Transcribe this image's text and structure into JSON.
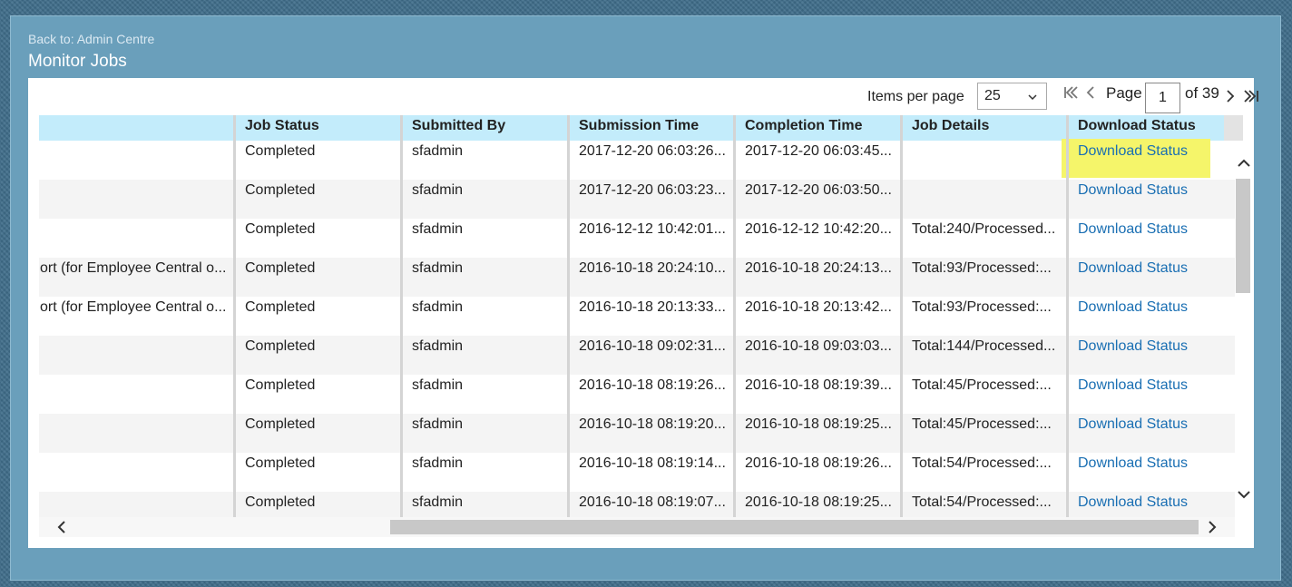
{
  "header": {
    "back_link": "Back to: Admin Centre",
    "title": "Monitor Jobs"
  },
  "pagination": {
    "items_per_page_label": "Items per page",
    "items_per_page_value": "25",
    "page_label": "Page",
    "current_page": "1",
    "of_label": "of 39"
  },
  "table": {
    "columns": [
      "Job Status",
      "Submitted By",
      "Submission Time",
      "Completion Time",
      "Job Details",
      "Download Status"
    ],
    "rows": [
      {
        "name": "",
        "status": "Completed",
        "submitted_by": "sfadmin",
        "submission_time": "2017-12-20 06:03:26...",
        "completion_time": "2017-12-20 06:03:45...",
        "details": "",
        "download": "Download Status"
      },
      {
        "name": "",
        "status": "Completed",
        "submitted_by": "sfadmin",
        "submission_time": "2017-12-20 06:03:23...",
        "completion_time": "2017-12-20 06:03:50...",
        "details": "",
        "download": "Download Status"
      },
      {
        "name": "",
        "status": "Completed",
        "submitted_by": "sfadmin",
        "submission_time": "2016-12-12 10:42:01...",
        "completion_time": "2016-12-12 10:42:20...",
        "details": "Total:240/Processed...",
        "download": "Download Status"
      },
      {
        "name": "ort (for Employee Central o...",
        "status": "Completed",
        "submitted_by": "sfadmin",
        "submission_time": "2016-10-18 20:24:10...",
        "completion_time": "2016-10-18 20:24:13...",
        "details": "Total:93/Processed:...",
        "download": "Download Status"
      },
      {
        "name": "ort (for Employee Central o...",
        "status": "Completed",
        "submitted_by": "sfadmin",
        "submission_time": "2016-10-18 20:13:33...",
        "completion_time": "2016-10-18 20:13:42...",
        "details": "Total:93/Processed:...",
        "download": "Download Status"
      },
      {
        "name": "",
        "status": "Completed",
        "submitted_by": "sfadmin",
        "submission_time": "2016-10-18 09:02:31...",
        "completion_time": "2016-10-18 09:03:03...",
        "details": "Total:144/Processed...",
        "download": "Download Status"
      },
      {
        "name": "",
        "status": "Completed",
        "submitted_by": "sfadmin",
        "submission_time": "2016-10-18 08:19:26...",
        "completion_time": "2016-10-18 08:19:39...",
        "details": "Total:45/Processed:...",
        "download": "Download Status"
      },
      {
        "name": "",
        "status": "Completed",
        "submitted_by": "sfadmin",
        "submission_time": "2016-10-18 08:19:20...",
        "completion_time": "2016-10-18 08:19:25...",
        "details": "Total:45/Processed:...",
        "download": "Download Status"
      },
      {
        "name": "",
        "status": "Completed",
        "submitted_by": "sfadmin",
        "submission_time": "2016-10-18 08:19:14...",
        "completion_time": "2016-10-18 08:19:26...",
        "details": "Total:54/Processed:...",
        "download": "Download Status"
      },
      {
        "name": "",
        "status": "Completed",
        "submitted_by": "sfadmin",
        "submission_time": "2016-10-18 08:19:07...",
        "completion_time": "2016-10-18 08:19:25...",
        "details": "Total:54/Processed:...",
        "download": "Download Status"
      }
    ]
  },
  "icons": {
    "first": "first-page-icon",
    "prev": "prev-page-icon",
    "next": "next-page-icon",
    "last": "last-page-icon",
    "select": "chevron-down-icon"
  },
  "colors": {
    "header_bg": "#c3ecfb",
    "link": "#1a6fb3",
    "highlight": "#f5f56a"
  }
}
